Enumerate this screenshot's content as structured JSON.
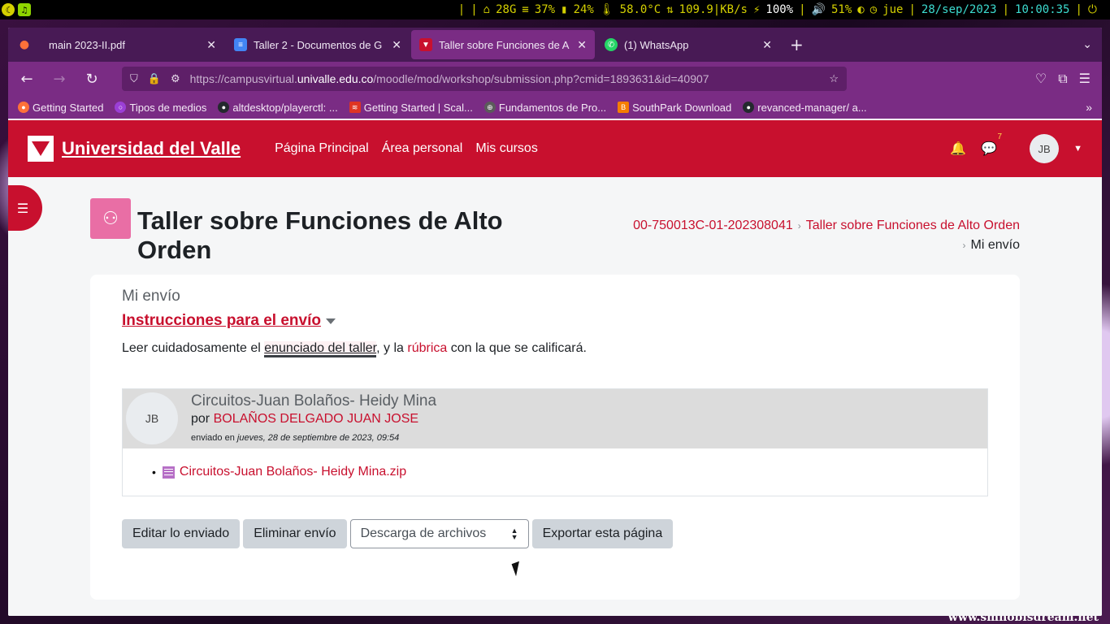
{
  "statusbar": {
    "disk": "28G",
    "mem": "37%",
    "cpu": "24%",
    "temp": "58.0°C",
    "net": "109.9|KB/s",
    "battery": "100%",
    "volume": "51%",
    "day": "jue",
    "date": "28/sep/2023",
    "time": "10:00:35"
  },
  "tabs": [
    {
      "title": "main 2023-II.pdf",
      "icon": "firefox-pdf-icon",
      "active": false
    },
    {
      "title": "Taller 2 - Documentos de G",
      "icon": "google-docs-icon",
      "active": false
    },
    {
      "title": "Taller sobre Funciones de A",
      "icon": "univalle-icon",
      "active": true
    },
    {
      "title": "(1) WhatsApp",
      "icon": "whatsapp-icon",
      "active": false
    }
  ],
  "url": {
    "prefix": "https://campusvirtual.",
    "domain": "univalle.edu.co",
    "path": "/moodle/mod/workshop/submission.php?cmid=1893631&id=40907"
  },
  "bookmarks": [
    {
      "label": "Getting Started",
      "color": "#ff7139"
    },
    {
      "label": "Tipos de medios",
      "color": "#9b3fd6"
    },
    {
      "label": "altdesktop/playerctl: ...",
      "color": "#24292e"
    },
    {
      "label": "Getting Started | Scal...",
      "color": "#de3423"
    },
    {
      "label": "Fundamentos de Pro...",
      "color": "#5b5b5b"
    },
    {
      "label": "SouthPark Download",
      "color": "#f57d00"
    },
    {
      "label": "revanced-manager/ a...",
      "color": "#24292e"
    }
  ],
  "site": {
    "name": "Universidad del Valle",
    "nav": [
      "Página Principal",
      "Área personal",
      "Mis cursos"
    ],
    "notif_count": "7",
    "user_initials": "JB",
    "brand_color": "#c8102e"
  },
  "page": {
    "title": "Taller sobre Funciones de Alto Orden",
    "breadcrumb": [
      "00-750013C-01-202308041",
      "Taller sobre Funciones de Alto Orden",
      "Mi envío"
    ]
  },
  "content": {
    "section_label": "Mi envío",
    "instructions_toggle": "Instrucciones para el envío",
    "instr_before": "Leer cuidadosamente el ",
    "instr_link1": "enunciado del taller",
    "instr_middle": ", y la ",
    "instr_link2": "rúbrica ",
    "instr_after": "con la que se calificará."
  },
  "submission": {
    "initials": "JB",
    "title": "Circuitos-Juan Bolaños- Heidy Mina",
    "by_label": "por ",
    "author": "BOLAÑOS DELGADO JUAN JOSE",
    "sent_label": "enviado en ",
    "sent_date": "jueves, 28 de septiembre de 2023, 09:54",
    "file": "Circuitos-Juan Bolaños- Heidy Mina.zip"
  },
  "actions": {
    "edit": "Editar lo enviado",
    "delete": "Eliminar envío",
    "download_select": "Descarga de archivos",
    "export": "Exportar esta página"
  }
}
